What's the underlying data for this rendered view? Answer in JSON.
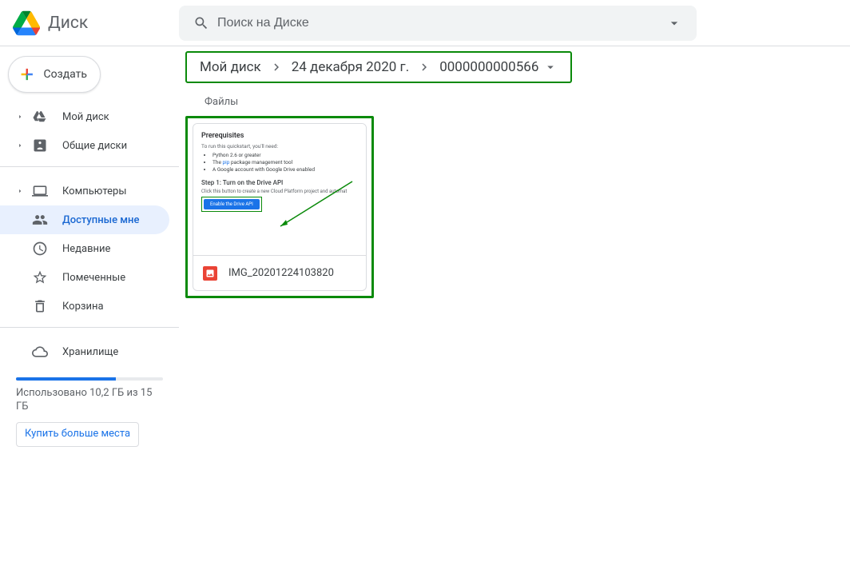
{
  "header": {
    "app_name": "Диск",
    "search_placeholder": "Поиск на Диске"
  },
  "sidebar": {
    "create_label": "Создать",
    "items": [
      {
        "label": "Мой диск",
        "icon": "drive",
        "expandable": true
      },
      {
        "label": "Общие диски",
        "icon": "shared-drive",
        "expandable": true
      }
    ],
    "items2": [
      {
        "label": "Компьютеры",
        "icon": "computer",
        "expandable": true
      },
      {
        "label": "Доступные мне",
        "icon": "shared-with-me",
        "selected": true
      },
      {
        "label": "Недавние",
        "icon": "recent"
      },
      {
        "label": "Помеченные",
        "icon": "starred"
      },
      {
        "label": "Корзина",
        "icon": "trash"
      }
    ],
    "storage_label": "Хранилище",
    "storage_used_text": "Использовано 10,2 ГБ из 15 ГБ",
    "buy_more": "Купить больше места"
  },
  "breadcrumb": {
    "items": [
      "Мой диск",
      "24 декабря 2020 г.",
      "0000000000566"
    ]
  },
  "content": {
    "files_label": "Файлы",
    "file": {
      "name": "IMG_20201224103820",
      "thumb": {
        "h1": "Prerequisites",
        "sub": "To run this quickstart, you'll need:",
        "li1": "Python 2.6 or greater",
        "li2_a": "The ",
        "li2_b": "pip",
        "li2_c": " package management tool",
        "li3": "A Google account with Google Drive enabled",
        "h2": "Step 1: Turn on the Drive API",
        "sub2": "Click this button to create a new Cloud Platform project and automat",
        "btn": "Enable the Drive API"
      }
    }
  }
}
